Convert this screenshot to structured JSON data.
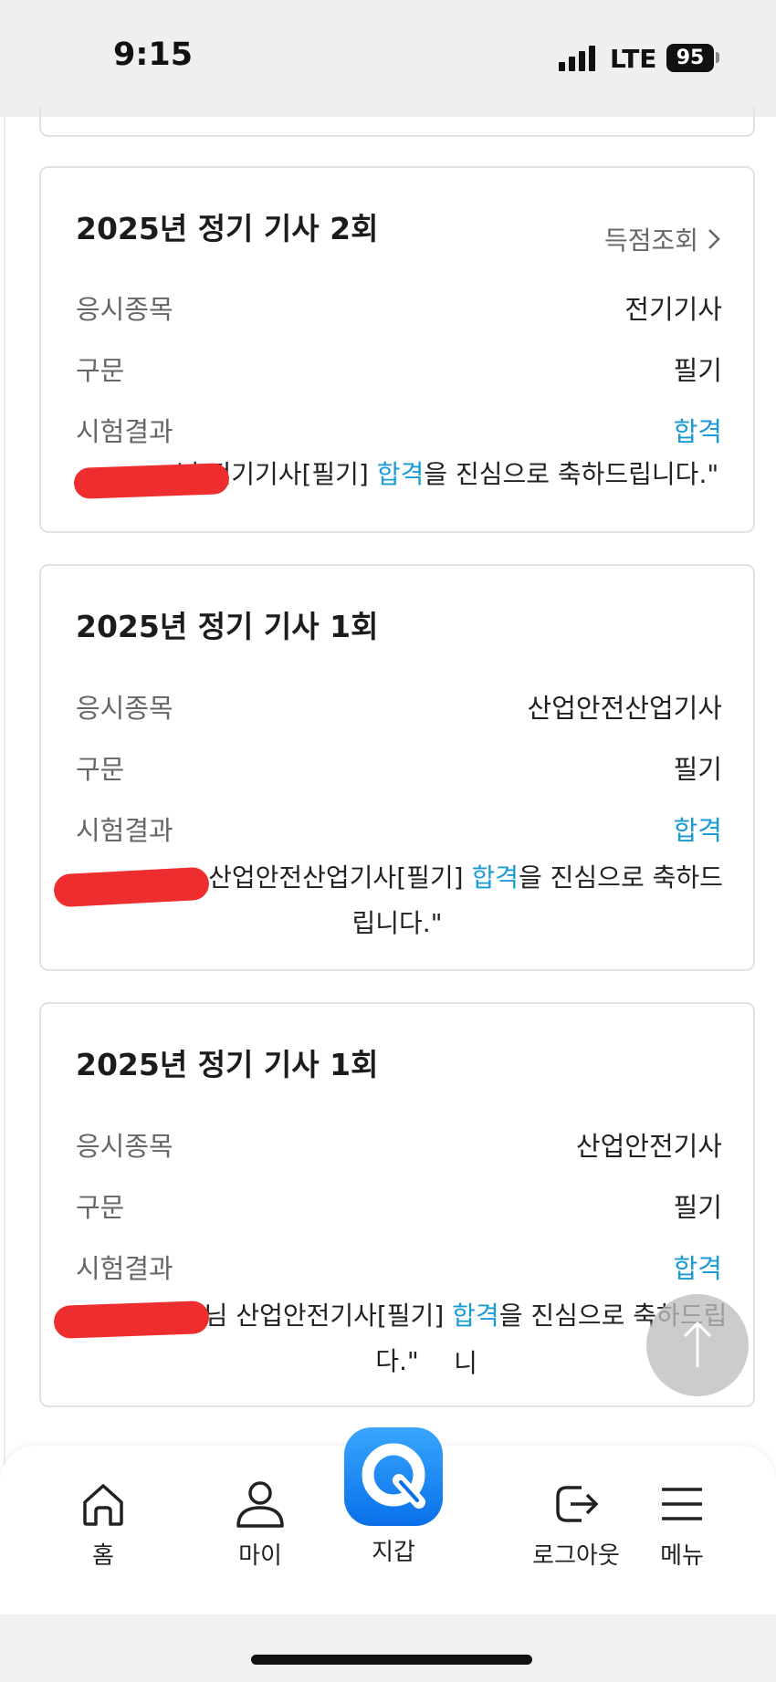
{
  "status_bar": {
    "time": "9:15",
    "network": "LTE",
    "battery": "95",
    "signal_icon": "signal-bars-icon"
  },
  "cards": [
    {
      "title": "2025년 정기 기사 2회",
      "link_label": "득점조회",
      "rows": [
        {
          "label": "응시종목",
          "value": "전기기사"
        },
        {
          "label": "구문",
          "value": "필기"
        },
        {
          "label": "시험결과",
          "value": "합격"
        }
      ],
      "message": {
        "before": "님 ",
        "exam": "전기기사[필기] ",
        "result": "합격",
        "after": "을 진심으로 축하드립니다.\""
      }
    },
    {
      "title": "2025년 정기 기사 1회",
      "rows": [
        {
          "label": "응시종목",
          "value": "산업안전산업기사"
        },
        {
          "label": "구문",
          "value": "필기"
        },
        {
          "label": "시험결과",
          "value": "합격"
        }
      ],
      "message": {
        "exam": "산업안전산업기사[필기] ",
        "result": "합격",
        "after": "을 진심으로 축하드",
        "line2": "립니다.\""
      }
    },
    {
      "title": "2025년 정기 기사 1회",
      "rows": [
        {
          "label": "응시종목",
          "value": "산업안전기사"
        },
        {
          "label": "구문",
          "value": "필기"
        },
        {
          "label": "시험결과",
          "value": "합격"
        }
      ],
      "message": {
        "before": "님 ",
        "exam": "산업안전기사[필기] ",
        "result": "합격",
        "after": "을 진심으로 축하드립니",
        "line2": "다.\""
      }
    }
  ],
  "bottom_nav": {
    "items": [
      {
        "label": "홈",
        "icon": "home-icon"
      },
      {
        "label": "마이",
        "icon": "person-icon"
      },
      {
        "label": "지갑",
        "icon": "q-wallet-icon"
      },
      {
        "label": "로그아웃",
        "icon": "logout-icon"
      },
      {
        "label": "메뉴",
        "icon": "hamburger-menu-icon"
      }
    ]
  },
  "colors": {
    "pass": "#1a9bd7",
    "accent": "#0a6fe8",
    "redaction": "#ee2e2e"
  }
}
